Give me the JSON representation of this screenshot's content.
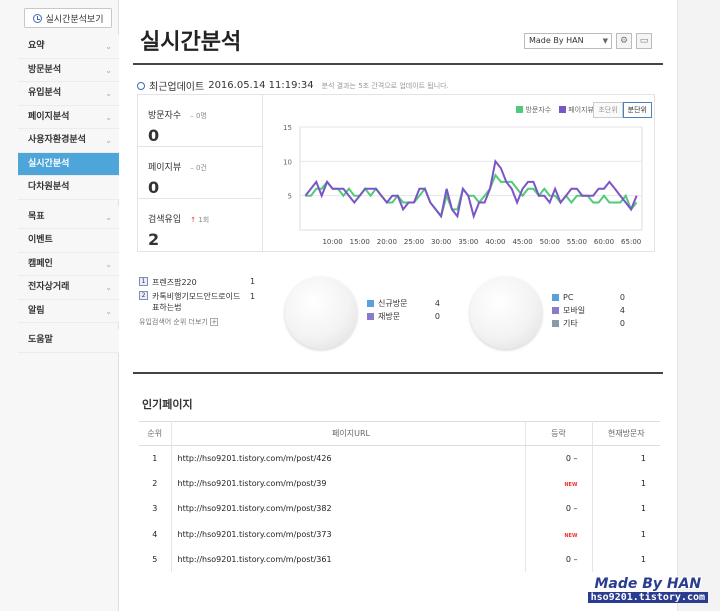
{
  "sidebar": {
    "realtime_button": "실시간분석보기",
    "items": [
      {
        "label": "요약",
        "chevron": true
      },
      {
        "label": "방문분석",
        "chevron": true
      },
      {
        "label": "유입분석",
        "chevron": true
      },
      {
        "label": "페이지분석",
        "chevron": true
      },
      {
        "label": "사용자환경분석",
        "chevron": true
      },
      {
        "label": "실시간분석",
        "chevron": false,
        "active": true
      },
      {
        "label": "다차원분석",
        "chevron": false
      },
      {
        "label": "목표",
        "chevron": true
      },
      {
        "label": "이벤트",
        "chevron": false
      },
      {
        "label": "캠페인",
        "chevron": true
      },
      {
        "label": "전자상거래",
        "chevron": true
      },
      {
        "label": "알림",
        "chevron": true
      },
      {
        "label": "도움말",
        "chevron": false
      }
    ]
  },
  "header": {
    "title": "실시간분석",
    "site_select": "Made By HAN"
  },
  "update": {
    "label": "최근업데이트",
    "timestamp": "2016.05.14 11:19:34",
    "info": "분석 결과는 5초 간격으로 업데이트 됩니다."
  },
  "stats": [
    {
      "label": "방문자수",
      "delta": "– 0명",
      "value": "0"
    },
    {
      "label": "페이지뷰",
      "delta": "– 0건",
      "value": "0"
    },
    {
      "label": "검색유입",
      "delta_arrow": "↑",
      "delta": "1회",
      "value": "2"
    }
  ],
  "chart_legend": [
    "방문자수",
    "페이지뷰"
  ],
  "unit_tabs": [
    "초단위",
    "분단위"
  ],
  "chart_data": {
    "type": "line",
    "x_ticks": [
      "10:00",
      "15:00",
      "20:00",
      "25:00",
      "30:00",
      "35:00",
      "40:00",
      "45:00",
      "50:00",
      "55:00",
      "60:00",
      "65:00"
    ],
    "ylim": [
      0,
      15
    ],
    "y_ticks": [
      5,
      10,
      15
    ],
    "x_range": [
      4,
      67
    ],
    "series": [
      {
        "name": "방문자수",
        "color": "#52c97a",
        "x": [
          5,
          6,
          7,
          8,
          9,
          10,
          11,
          12,
          13,
          14,
          15,
          16,
          17,
          18,
          19,
          20,
          21,
          22,
          23,
          24,
          25,
          26,
          27,
          28,
          29,
          30,
          31,
          32,
          33,
          34,
          35,
          36,
          37,
          38,
          39,
          40,
          41,
          42,
          43,
          44,
          45,
          46,
          47,
          48,
          49,
          50,
          51,
          52,
          53,
          54,
          55,
          56,
          57,
          58,
          59,
          60,
          61,
          62,
          63,
          64,
          65,
          66
        ],
        "values": [
          5,
          5,
          6,
          6,
          7,
          6,
          6,
          5,
          6,
          5,
          5,
          6,
          5,
          6,
          5,
          4,
          4,
          5,
          4,
          4,
          4,
          5,
          6,
          4,
          3,
          2,
          5,
          3,
          3,
          6,
          5,
          5,
          4,
          5,
          6,
          8,
          7,
          7,
          7,
          6,
          5,
          6,
          6,
          5,
          6,
          5,
          5,
          4,
          5,
          4,
          5,
          5,
          5,
          4,
          4,
          5,
          4,
          4,
          4,
          5,
          3,
          4
        ]
      },
      {
        "name": "페이지뷰",
        "color": "#7b55c7",
        "x": [
          5,
          6,
          7,
          8,
          9,
          10,
          11,
          12,
          13,
          14,
          15,
          16,
          17,
          18,
          19,
          20,
          21,
          22,
          23,
          24,
          25,
          26,
          27,
          28,
          29,
          30,
          31,
          32,
          33,
          34,
          35,
          36,
          37,
          38,
          39,
          40,
          41,
          42,
          43,
          44,
          45,
          46,
          47,
          48,
          49,
          50,
          51,
          52,
          53,
          54,
          55,
          56,
          57,
          58,
          59,
          60,
          61,
          62,
          63,
          64,
          65,
          66
        ],
        "values": [
          5,
          6,
          7,
          5,
          7,
          6,
          6,
          6,
          5,
          4,
          5,
          6,
          6,
          6,
          5,
          4,
          5,
          5,
          3,
          4,
          4,
          6,
          6,
          4,
          3,
          2,
          6,
          3,
          2,
          6,
          5,
          2,
          4,
          4,
          6,
          10,
          9,
          7,
          6,
          4,
          6,
          7,
          7,
          5,
          5,
          4,
          6,
          4,
          5,
          6,
          6,
          5,
          5,
          5,
          6,
          6,
          7,
          6,
          5,
          4,
          3,
          5
        ]
      }
    ]
  },
  "keywords": {
    "items": [
      {
        "rank": "1",
        "text": "프렌즈팝220",
        "count": "1"
      },
      {
        "rank": "2",
        "text": "카톡비행기모드안드로이드표하는법",
        "count": "1"
      }
    ],
    "more": "유입검색어 순위 더보기"
  },
  "visit_type": [
    {
      "label": "신규방문",
      "count": "4",
      "color": "#5aa0dc"
    },
    {
      "label": "재방문",
      "count": "0",
      "color": "#8a7bc9"
    }
  ],
  "device": [
    {
      "label": "PC",
      "count": "0",
      "color": "#5aa0dc"
    },
    {
      "label": "모바일",
      "count": "4",
      "color": "#8a7bc9"
    },
    {
      "label": "기타",
      "count": "0",
      "color": "#8a9aa6"
    }
  ],
  "popular": {
    "title": "인기페이지",
    "headers": [
      "순위",
      "페이지URL",
      "등락",
      "현재방문자"
    ],
    "rows": [
      {
        "rank": "1",
        "url": "http://hso9201.tistory.com/m/post/426",
        "change": "0 –",
        "is_new": false,
        "current": "1"
      },
      {
        "rank": "2",
        "url": "http://hso9201.tistory.com/m/post/39",
        "change": "NEW",
        "is_new": true,
        "current": "1"
      },
      {
        "rank": "3",
        "url": "http://hso9201.tistory.com/m/post/382",
        "change": "0 –",
        "is_new": false,
        "current": "1"
      },
      {
        "rank": "4",
        "url": "http://hso9201.tistory.com/m/post/373",
        "change": "NEW",
        "is_new": true,
        "current": "1"
      },
      {
        "rank": "5",
        "url": "http://hso9201.tistory.com/m/post/361",
        "change": "0 –",
        "is_new": false,
        "current": "1"
      }
    ]
  },
  "watermark": {
    "title": "Made By HAN",
    "url": "hso9201.tistory.com"
  }
}
